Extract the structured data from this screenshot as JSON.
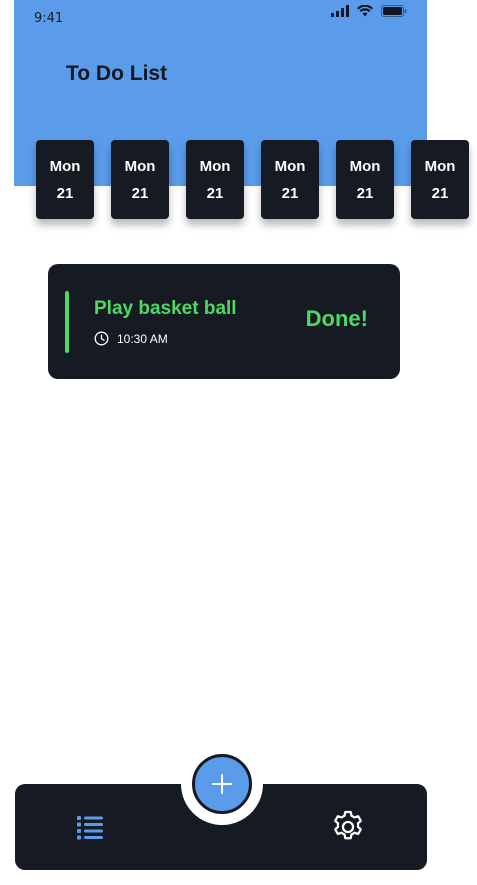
{
  "status_bar": {
    "time": "9:41",
    "icons": [
      "signal-icon",
      "wifi-icon",
      "battery-icon"
    ]
  },
  "header": {
    "title": "To Do List",
    "background_color": "#5a9bea"
  },
  "dates": [
    {
      "day": "Mon",
      "num": "21"
    },
    {
      "day": "Mon",
      "num": "21"
    },
    {
      "day": "Mon",
      "num": "21"
    },
    {
      "day": "Mon",
      "num": "21"
    },
    {
      "day": "Mon",
      "num": "21"
    },
    {
      "day": "Mon",
      "num": "21"
    }
  ],
  "tasks": [
    {
      "title": "Play basket ball",
      "time": "10:30 AM",
      "status": "Done!",
      "accent_color": "#4cd964",
      "icon": "clock-icon"
    }
  ],
  "bottom_nav": {
    "left_icon": "list-icon",
    "center_icon": "plus-icon",
    "right_icon": "gear-icon",
    "accent_color": "#5a9bea",
    "background_color": "#161a22"
  }
}
